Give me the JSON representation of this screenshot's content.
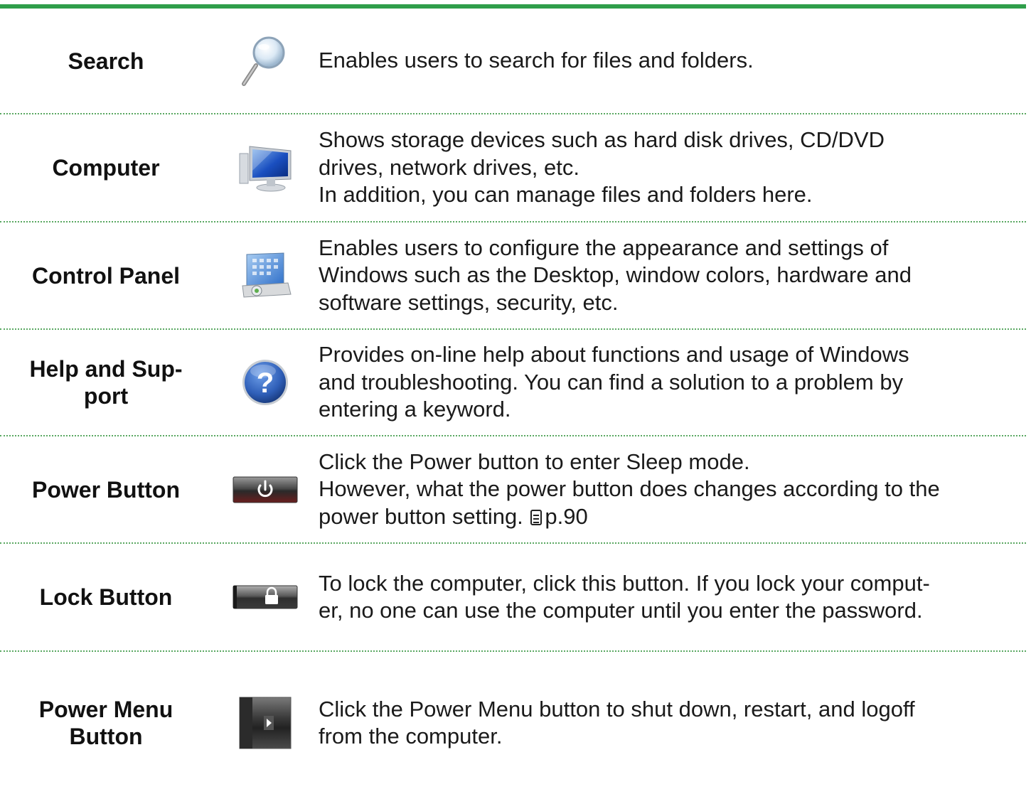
{
  "rows": [
    {
      "term": "Search",
      "icon": "magnifier-icon",
      "desc": [
        "Enables users to search for files and folders."
      ]
    },
    {
      "term": "Computer",
      "icon": "computer-monitor-icon",
      "desc": [
        "Shows storage devices such as hard disk drives, CD/DVD",
        "drives, network drives, etc.",
        "In addition, you can manage files and folders here."
      ]
    },
    {
      "term": "Control Panel",
      "icon": "control-panel-icon",
      "desc": [
        "Enables users to configure the appearance and settings of",
        "Windows such as the Desktop, window colors, hardware and",
        "software settings, security, etc."
      ]
    },
    {
      "term_lines": [
        "Help and Sup-",
        "port"
      ],
      "icon": "help-question-icon",
      "desc": [
        "Provides on-line help about functions and usage of Windows",
        "and troubleshooting. You can find a solution to a problem by",
        "entering a keyword."
      ]
    },
    {
      "term": "Power Button",
      "icon": "power-button-icon",
      "desc": [
        "Click the Power button to enter Sleep mode.",
        "However, what the power button does changes according to the",
        "power button setting."
      ],
      "ref": "p.90"
    },
    {
      "term": "Lock Button",
      "icon": "lock-button-icon",
      "desc": [
        "To lock the computer, click this button. If you lock your comput-",
        "er, no one can use the computer until you enter the password."
      ]
    },
    {
      "term_lines": [
        "Power Menu",
        "Button"
      ],
      "icon": "power-menu-button-icon",
      "desc": [
        "Click the Power Menu button to shut down, restart, and logoff",
        "from the computer."
      ]
    }
  ],
  "colors": {
    "accent_green": "#2f9e4a",
    "divider_green": "#5aa862",
    "help_blue": "#2f5fb8"
  }
}
